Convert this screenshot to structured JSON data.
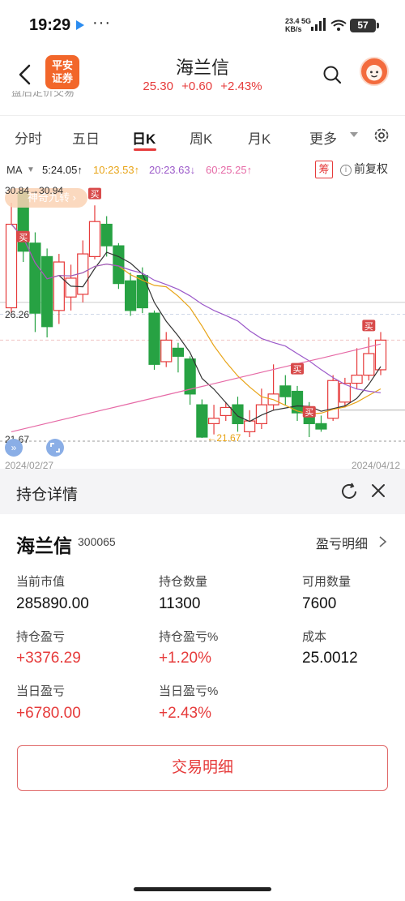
{
  "status_bar": {
    "time": "19:29",
    "dots": "···",
    "net_speed": "23.4",
    "net_unit": "KB/s",
    "net_type": "5G",
    "battery": "57"
  },
  "header": {
    "logo_line1": "平安",
    "logo_line2": "证券",
    "stock_name": "海兰信",
    "price": "25.30",
    "change": "+0.60",
    "change_pct": "+2.43%",
    "partial_text": "盘后定价交易"
  },
  "tabs": [
    {
      "label": "分时",
      "active": false
    },
    {
      "label": "五日",
      "active": false
    },
    {
      "label": "日K",
      "active": true
    },
    {
      "label": "周K",
      "active": false
    },
    {
      "label": "月K",
      "active": false
    },
    {
      "label": "更多",
      "active": false
    }
  ],
  "ma": {
    "label": "MA",
    "items": [
      {
        "text": "5:24.05↑",
        "color": "#333333"
      },
      {
        "text": "10:23.53↑",
        "color": "#e8a417"
      },
      {
        "text": "20:23.63↓",
        "color": "#9b59c9"
      },
      {
        "text": "60:25.25↑",
        "color": "#e66aa6"
      }
    ],
    "chou_label": "筹",
    "fq_icon": "i",
    "fq_label": "前复权"
  },
  "chart": {
    "nine_turn_badge": "神奇九转 ›",
    "high_label": "30.84",
    "high_label2": "30.94",
    "mid_label": "26.26",
    "low_label": "21.67",
    "min_marker": "21.67",
    "date_left": "2024/02/27",
    "date_right": "2024/04/12",
    "buy_label": "买",
    "ff_icon": "»"
  },
  "chart_data": {
    "type": "candlestick",
    "y_axis_ticks": [
      30.84,
      26.26,
      21.67
    ],
    "x_axis_labels": [
      "2024/02/27",
      "2024/04/12"
    ],
    "highest_price": 30.94,
    "lowest_price": 21.67,
    "series": [
      {
        "name": "MA5",
        "last_value": 24.05,
        "color": "#333333"
      },
      {
        "name": "MA10",
        "last_value": 23.53,
        "color": "#e8a417"
      },
      {
        "name": "MA20",
        "last_value": 23.63,
        "color": "#9b59c9"
      },
      {
        "name": "MA60",
        "last_value": 25.25,
        "color": "#e66aa6"
      }
    ],
    "candles": [
      {
        "dir": "up",
        "open": 26.5,
        "close": 29.6,
        "high": 30.4,
        "low": 26.3
      },
      {
        "dir": "down",
        "open": 30.8,
        "close": 28.6,
        "high": 30.94,
        "low": 28.2
      },
      {
        "dir": "down",
        "open": 28.9,
        "close": 26.3,
        "high": 29.3,
        "low": 25.6
      },
      {
        "dir": "down",
        "open": 28.4,
        "close": 25.8,
        "high": 28.7,
        "low": 25.4
      },
      {
        "dir": "up",
        "open": 26.4,
        "close": 28.2,
        "high": 28.5,
        "low": 25.9
      },
      {
        "dir": "up",
        "open": 26.9,
        "close": 27.6,
        "high": 28.1,
        "low": 26.4
      },
      {
        "dir": "up",
        "open": 27.0,
        "close": 28.5,
        "high": 29.0,
        "low": 26.7
      },
      {
        "dir": "up",
        "open": 28.4,
        "close": 29.7,
        "high": 30.3,
        "low": 28.3
      },
      {
        "dir": "down",
        "open": 29.6,
        "close": 28.8,
        "high": 29.9,
        "low": 28.4
      },
      {
        "dir": "down",
        "open": 28.8,
        "close": 27.4,
        "high": 28.9,
        "low": 27.2
      },
      {
        "dir": "down",
        "open": 27.5,
        "close": 26.4,
        "high": 27.8,
        "low": 26.2
      },
      {
        "dir": "down",
        "open": 27.7,
        "close": 26.5,
        "high": 28.0,
        "low": 26.3
      },
      {
        "dir": "down",
        "open": 26.3,
        "close": 24.4,
        "high": 26.4,
        "low": 24.2
      },
      {
        "dir": "up",
        "open": 24.5,
        "close": 25.3,
        "high": 25.6,
        "low": 24.3
      },
      {
        "dir": "down",
        "open": 25.0,
        "close": 24.7,
        "high": 25.2,
        "low": 24.1
      },
      {
        "dir": "down",
        "open": 24.6,
        "close": 23.3,
        "high": 24.7,
        "low": 22.9
      },
      {
        "dir": "down",
        "open": 22.9,
        "close": 21.7,
        "high": 23.1,
        "low": 21.67
      },
      {
        "dir": "up",
        "open": 22.2,
        "close": 22.4,
        "high": 22.9,
        "low": 21.8
      },
      {
        "dir": "up",
        "open": 22.5,
        "close": 22.8,
        "high": 23.0,
        "low": 22.3
      },
      {
        "dir": "down",
        "open": 22.9,
        "close": 22.2,
        "high": 23.2,
        "low": 21.9
      },
      {
        "dir": "up",
        "open": 21.9,
        "close": 22.3,
        "high": 22.7,
        "low": 21.7
      },
      {
        "dir": "up",
        "open": 22.2,
        "close": 22.9,
        "high": 23.5,
        "low": 22.0
      },
      {
        "dir": "up",
        "open": 22.9,
        "close": 23.3,
        "high": 24.4,
        "low": 22.7
      },
      {
        "dir": "down",
        "open": 23.6,
        "close": 23.2,
        "high": 24.0,
        "low": 22.9
      },
      {
        "dir": "down",
        "open": 23.4,
        "close": 22.6,
        "high": 23.6,
        "low": 22.3
      },
      {
        "dir": "down",
        "open": 22.8,
        "close": 22.2,
        "high": 23.0,
        "low": 21.7
      },
      {
        "dir": "down",
        "open": 22.2,
        "close": 22.0,
        "high": 22.5,
        "low": 21.9
      },
      {
        "dir": "up",
        "open": 22.4,
        "close": 23.8,
        "high": 24.0,
        "low": 22.3
      },
      {
        "dir": "up",
        "open": 23.0,
        "close": 23.7,
        "high": 23.9,
        "low": 22.8
      },
      {
        "dir": "up",
        "open": 23.7,
        "close": 24.0,
        "high": 25.0,
        "low": 23.5
      },
      {
        "dir": "up",
        "open": 24.0,
        "close": 24.8,
        "high": 25.4,
        "low": 23.8
      },
      {
        "dir": "up",
        "open": 24.2,
        "close": 25.3,
        "high": 25.6,
        "low": 24.0
      }
    ]
  },
  "panel": {
    "title": "持仓详情",
    "stock_name": "海兰信",
    "stock_code": "300065",
    "detail_link": "盈亏明细",
    "metrics": [
      {
        "label": "当前市值",
        "value": "285890.00",
        "up": false
      },
      {
        "label": "持仓数量",
        "value": "11300",
        "up": false
      },
      {
        "label": "可用数量",
        "value": "7600",
        "up": false
      },
      {
        "label": "持仓盈亏",
        "value": "+3376.29",
        "up": true
      },
      {
        "label": "持仓盈亏%",
        "value": "+1.20%",
        "up": true
      },
      {
        "label": "成本",
        "value": "25.0012",
        "up": false
      },
      {
        "label": "当日盈亏",
        "value": "+6780.00",
        "up": true
      },
      {
        "label": "当日盈亏%",
        "value": "+2.43%",
        "up": true
      }
    ],
    "trade_button": "交易明细"
  },
  "colors": {
    "up": "#e63b3b",
    "down": "#27a243",
    "accent": "#e63b3b"
  }
}
